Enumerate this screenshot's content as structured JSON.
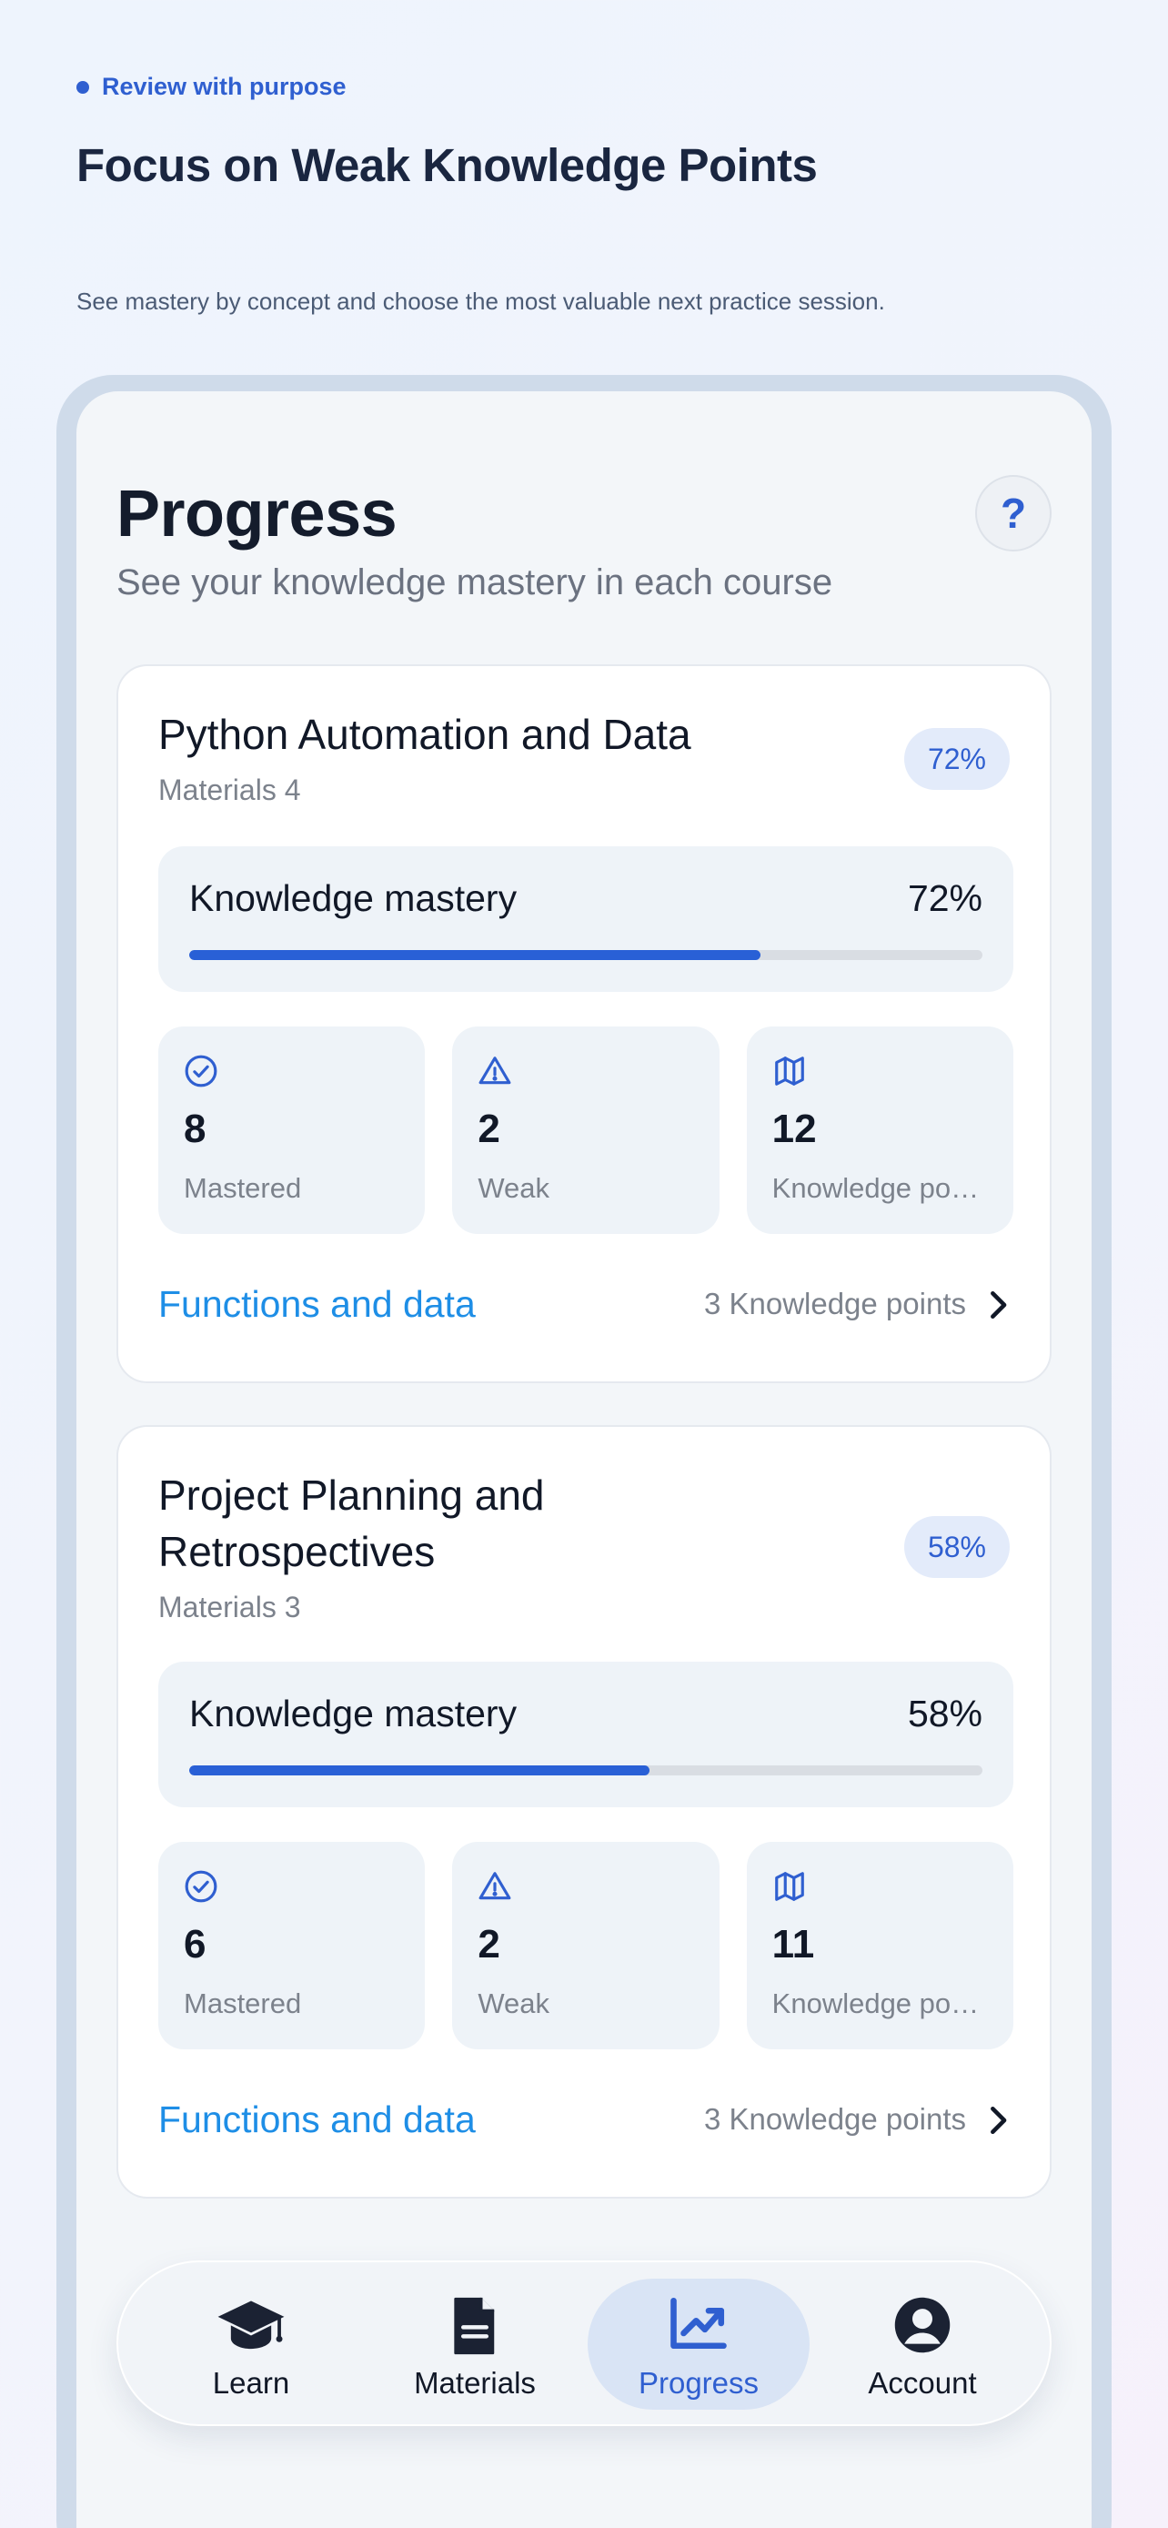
{
  "hero": {
    "eyebrow": "Review with purpose",
    "title": "Focus on Weak Knowledge Points",
    "description": "See mastery by concept and choose the most valuable next practice session."
  },
  "screen": {
    "title": "Progress",
    "subtitle": "See your knowledge mastery in each course",
    "help_label": "?"
  },
  "courses": [
    {
      "name": "Python Automation and Data",
      "materials": "Materials 4",
      "badge": "72%",
      "mastery_label": "Knowledge mastery",
      "mastery_value": "72%",
      "mastery_fraction": 0.72,
      "stats": [
        {
          "value": "8",
          "label": "Mastered",
          "icon": "check-circle-icon"
        },
        {
          "value": "2",
          "label": "Weak",
          "icon": "warning-triangle-icon"
        },
        {
          "value": "12",
          "label": "Knowledge po…",
          "icon": "map-icon"
        }
      ],
      "topic": {
        "name": "Functions and data",
        "count": "3 Knowledge points"
      }
    },
    {
      "name": "Project Planning and Retrospectives",
      "materials": "Materials 3",
      "badge": "58%",
      "mastery_label": "Knowledge mastery",
      "mastery_value": "58%",
      "mastery_fraction": 0.58,
      "stats": [
        {
          "value": "6",
          "label": "Mastered",
          "icon": "check-circle-icon"
        },
        {
          "value": "2",
          "label": "Weak",
          "icon": "warning-triangle-icon"
        },
        {
          "value": "11",
          "label": "Knowledge po…",
          "icon": "map-icon"
        }
      ],
      "topic": {
        "name": "Functions and data",
        "count": "3 Knowledge points"
      }
    }
  ],
  "tabs": [
    {
      "label": "Learn",
      "icon": "graduation-cap-icon",
      "active": false
    },
    {
      "label": "Materials",
      "icon": "document-icon",
      "active": false
    },
    {
      "label": "Progress",
      "icon": "chart-line-icon",
      "active": true
    },
    {
      "label": "Account",
      "icon": "user-circle-icon",
      "active": false
    }
  ],
  "colors": {
    "accent": "#2f5fd0",
    "bar_fill": "#2960d6",
    "topic_link": "#1e8ee6",
    "active_tab_bg": "#d9e4f5"
  }
}
